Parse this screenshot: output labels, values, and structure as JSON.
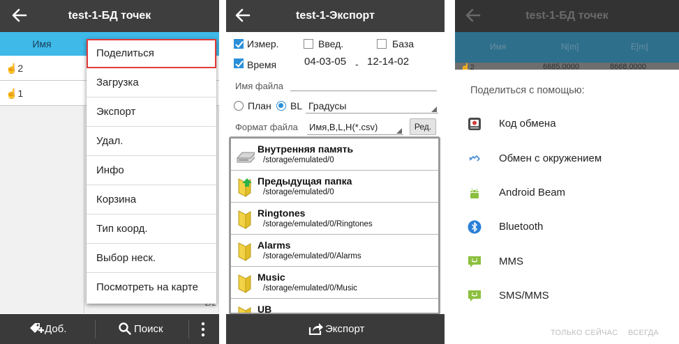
{
  "panel1": {
    "title": "test-1-БД точек",
    "column_header": "Имя",
    "rows": [
      "☝2",
      "☝1"
    ],
    "pager": "2/2",
    "menu_items": [
      "Поделиться",
      "Загрузка",
      "Экспорт",
      "Удал.",
      "Инфо",
      "Корзина",
      "Тип коорд.",
      "Выбор неск.",
      "Посмотреть на карте"
    ],
    "bottom": {
      "add_label": "Доб.",
      "search_label": "Поиск"
    }
  },
  "panel2": {
    "title": "test-1-Экспорт",
    "checks": [
      {
        "label": "Измер.",
        "checked": true
      },
      {
        "label": "Введ.",
        "checked": false
      },
      {
        "label": "База",
        "checked": false
      },
      {
        "label": "Время",
        "checked": true
      }
    ],
    "date_from": "04-03-05",
    "date_sep": "-",
    "date_to": "12-14-02",
    "filename_label": "Имя файла",
    "filename_value": "",
    "radio_plan": "План",
    "radio_bl": "BL",
    "units": "Градусы",
    "format_label": "Формат файла",
    "format_value": "Имя,B,L,H(*.csv)",
    "edit_button": "Ред.",
    "files": [
      {
        "name": "Внутренняя память",
        "path": "/storage/emulated/0",
        "icon": "drive-icon"
      },
      {
        "name": "Предыдущая папка",
        "path": "/storage/emulated/0",
        "icon": "folder-up-icon"
      },
      {
        "name": "Ringtones",
        "path": "/storage/emulated/0/Ringtones",
        "icon": "folder-icon"
      },
      {
        "name": "Alarms",
        "path": "/storage/emulated/0/Alarms",
        "icon": "folder-icon"
      },
      {
        "name": "Music",
        "path": "/storage/emulated/0/Music",
        "icon": "folder-icon"
      },
      {
        "name": "UB",
        "path": "",
        "icon": "folder-icon"
      }
    ],
    "export_label": "Экспорт"
  },
  "panel3": {
    "title": "test-1-БД точек",
    "headers": [
      "Имя",
      "N[m]",
      "E[m]"
    ],
    "peek_row": [
      "☝2",
      "6685.0000",
      "8668.0000"
    ],
    "share_title": "Поделиться с помощью:",
    "targets": [
      {
        "label": "Код обмена",
        "icon": "exchange-code-icon"
      },
      {
        "label": "Обмен с окружением",
        "icon": "nearby-share-icon"
      },
      {
        "label": "Android Beam",
        "icon": "android-icon"
      },
      {
        "label": "Bluetooth",
        "icon": "bluetooth-icon"
      },
      {
        "label": "MMS",
        "icon": "mms-icon"
      },
      {
        "label": "SMS/MMS",
        "icon": "sms-icon"
      }
    ],
    "just_once": "ТОЛЬКО СЕЙЧАС",
    "always": "ВСЕГДА"
  },
  "colors": {
    "titlebar": "#3e3e3e",
    "header_blue": "#3eb9e8",
    "highlight": "#e23a3a",
    "accent": "#2a8fd8",
    "folder_yellow": "#f3d247"
  }
}
